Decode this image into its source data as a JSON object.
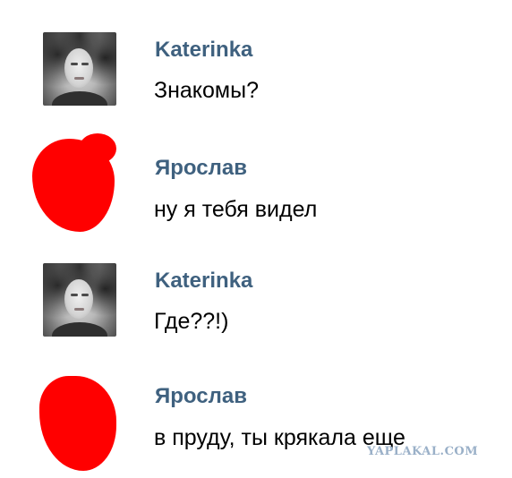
{
  "messages": [
    {
      "sender": "Katerinka",
      "text": "Знакомы?",
      "avatar": "user-photo"
    },
    {
      "sender": "Ярослав",
      "text": "ну я тебя видел",
      "avatar": "redacted-scribble"
    },
    {
      "sender": "Katerinka",
      "text": "Где??!)",
      "avatar": "user-photo"
    },
    {
      "sender": "Ярослав",
      "text": "в пруду, ты крякала еще",
      "avatar": "redacted-scribble"
    }
  ],
  "watermark": "YAPLAKAL.COM",
  "colors": {
    "sender_name": "#3f617f",
    "message_text": "#000000",
    "redaction": "#ff0000",
    "background": "#ffffff"
  }
}
